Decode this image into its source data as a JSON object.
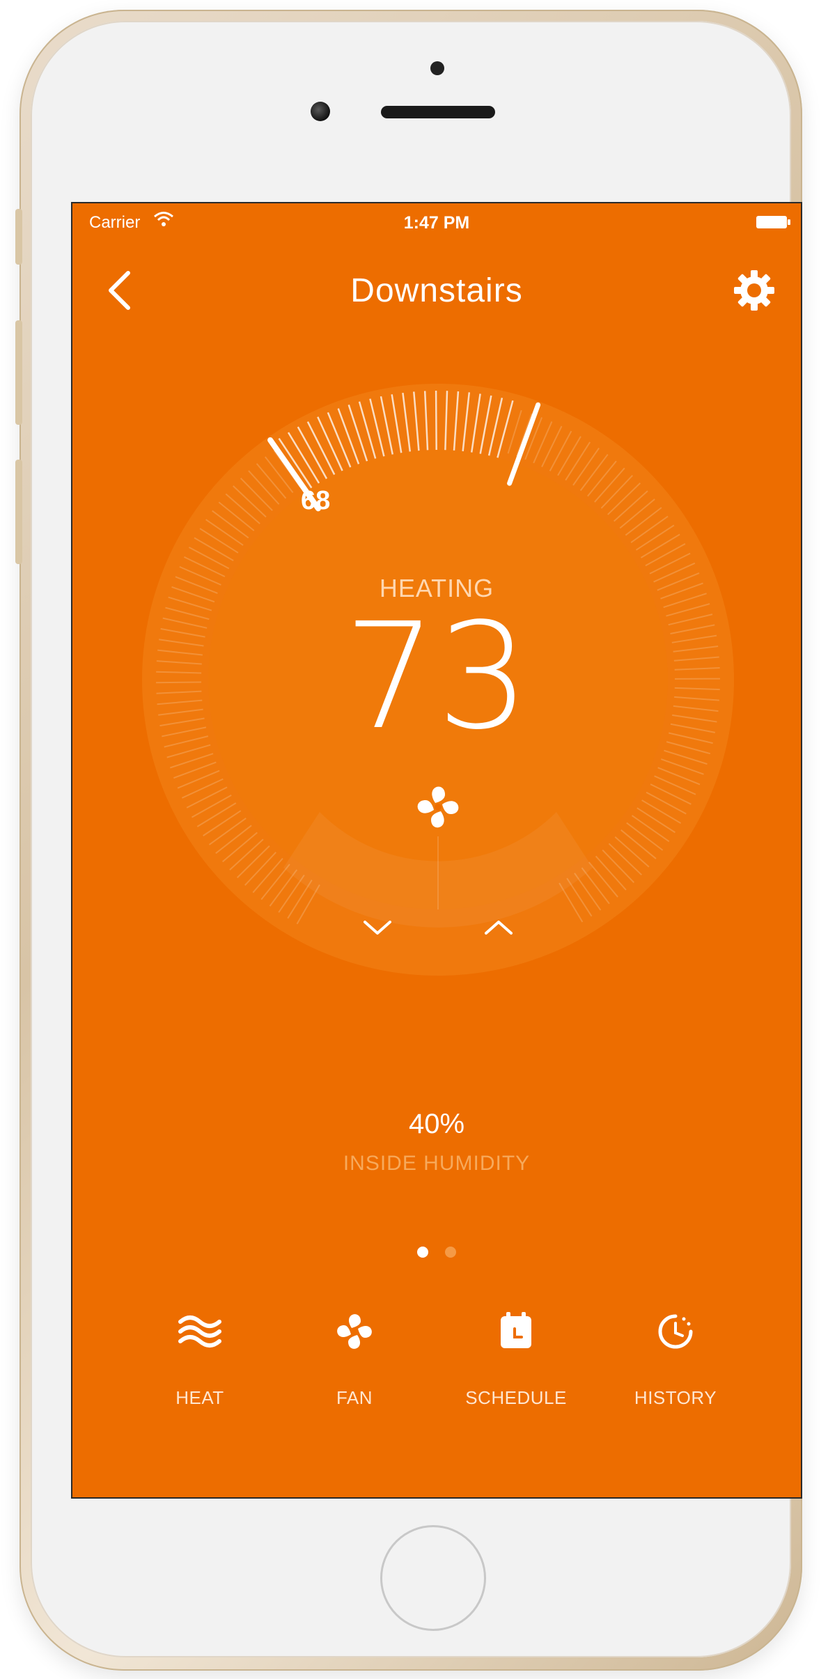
{
  "status_bar": {
    "carrier": "Carrier",
    "time": "1:47 PM"
  },
  "nav": {
    "title": "Downstairs"
  },
  "thermostat": {
    "mode_label": "HEATING",
    "current_temp": "73",
    "setpoint": "68"
  },
  "humidity": {
    "value": "40%",
    "label": "INSIDE HUMIDITY"
  },
  "page_indicator": {
    "active": 1,
    "count": 2
  },
  "tabs": [
    {
      "label": "HEAT",
      "icon": "heat-waves-icon"
    },
    {
      "label": "FAN",
      "icon": "fan-icon"
    },
    {
      "label": "SCHEDULE",
      "icon": "calendar-clock-icon"
    },
    {
      "label": "HISTORY",
      "icon": "history-clock-icon"
    }
  ],
  "colors": {
    "accent": "#ED6D00",
    "text": "#FFFFFF",
    "muted": "#F7A95B"
  }
}
